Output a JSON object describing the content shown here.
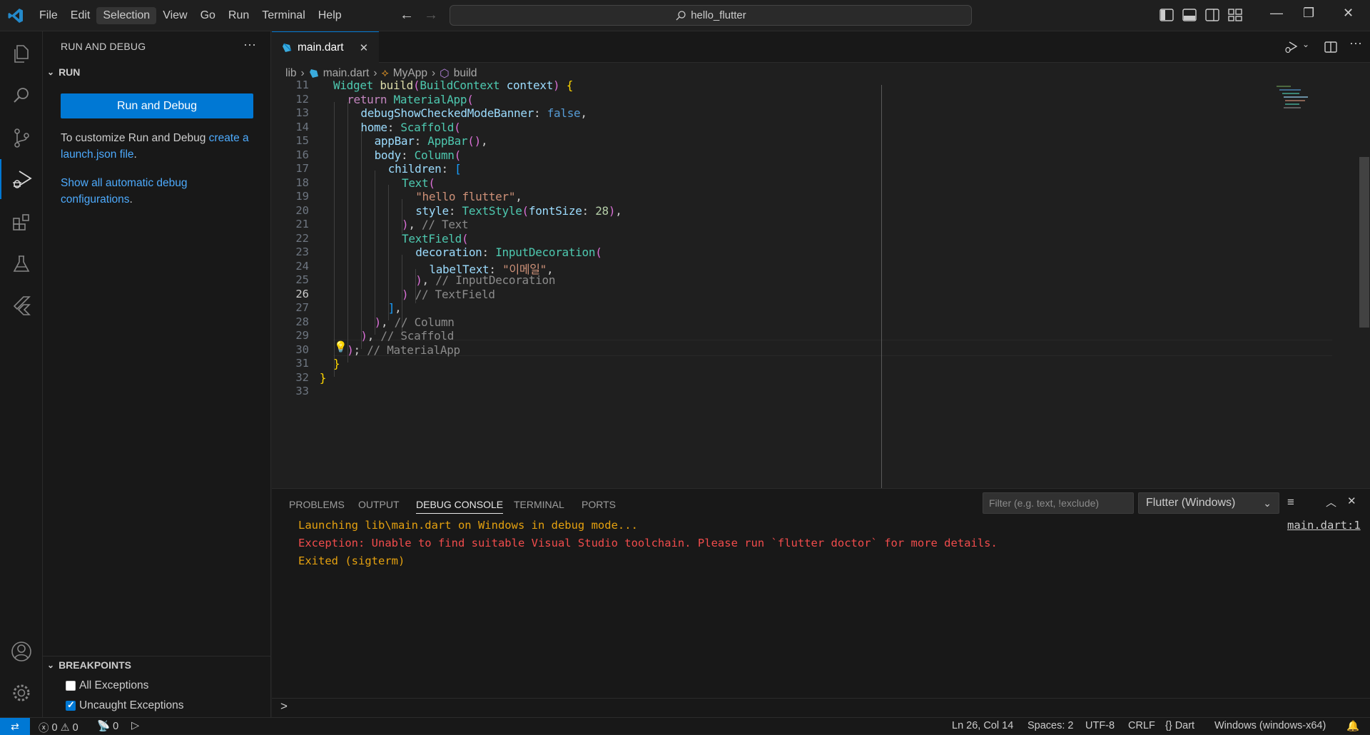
{
  "titlebar": {
    "menu": [
      "File",
      "Edit",
      "Selection",
      "View",
      "Go",
      "Run",
      "Terminal",
      "Help"
    ],
    "active_menu": "Selection",
    "search_text": "hello_flutter"
  },
  "sidebar": {
    "title": "RUN AND DEBUG",
    "run_section": "RUN",
    "run_button": "Run and Debug",
    "customize_text": "To customize Run and Debug ",
    "customize_link": "create a launch.json file",
    "customize_end": ".",
    "show_all_link": "Show all automatic debug configurations",
    "show_all_end": ".",
    "breakpoints_section": "BREAKPOINTS",
    "breakpoints": [
      {
        "label": "All Exceptions",
        "checked": false
      },
      {
        "label": "Uncaught Exceptions",
        "checked": true
      }
    ]
  },
  "editor": {
    "tab": "main.dart",
    "breadcrumb": [
      "lib",
      "main.dart",
      "MyApp",
      "build"
    ],
    "current_line": 26,
    "lines": [
      {
        "n": "11",
        "text": "Widget build(BuildContext context) {"
      },
      {
        "n": "12",
        "text": "return MaterialApp("
      },
      {
        "n": "13",
        "text": "debugShowCheckedModeBanner: false,"
      },
      {
        "n": "14",
        "text": "home: Scaffold("
      },
      {
        "n": "15",
        "text": "appBar: AppBar(),"
      },
      {
        "n": "16",
        "text": "body: Column("
      },
      {
        "n": "17",
        "text": "children: ["
      },
      {
        "n": "18",
        "text": "Text("
      },
      {
        "n": "19",
        "text": "\"hello flutter\","
      },
      {
        "n": "20",
        "text": "style: TextStyle(fontSize: 28),"
      },
      {
        "n": "21",
        "text": "), // Text"
      },
      {
        "n": "22",
        "text": "TextField("
      },
      {
        "n": "23",
        "text": "decoration: InputDecoration("
      },
      {
        "n": "24",
        "text": "labelText: \"이메일\","
      },
      {
        "n": "25",
        "text": "), // InputDecoration"
      },
      {
        "n": "26",
        "text": ") // TextField"
      },
      {
        "n": "27",
        "text": "],"
      },
      {
        "n": "28",
        "text": "), // Column"
      },
      {
        "n": "29",
        "text": "), // Scaffold"
      },
      {
        "n": "30",
        "text": "); // MaterialApp"
      },
      {
        "n": "31",
        "text": "}"
      },
      {
        "n": "32",
        "text": "}"
      },
      {
        "n": "33",
        "text": ""
      }
    ]
  },
  "panel": {
    "tabs": [
      "PROBLEMS",
      "OUTPUT",
      "DEBUG CONSOLE",
      "TERMINAL",
      "PORTS"
    ],
    "active_tab": "DEBUG CONSOLE",
    "filter_placeholder": "Filter (e.g. text, !exclude)",
    "target": "Flutter (Windows)",
    "output": [
      {
        "text": "Launching lib\\main.dart on Windows in debug mode...",
        "color": "#e5a10f"
      },
      {
        "text": "Exception: Unable to find suitable Visual Studio toolchain. Please run `flutter doctor` for more details.",
        "color": "#f14c4c"
      },
      {
        "text": "Exited (sigterm)",
        "color": "#e5a10f"
      }
    ],
    "source_link": "main.dart:1",
    "prompt": ">"
  },
  "statusbar": {
    "errors": "0",
    "warnings": "0",
    "ports": "0",
    "position": "Ln 26, Col 14",
    "spaces": "Spaces: 2",
    "encoding": "UTF-8",
    "eol": "CRLF",
    "language": "Dart",
    "device": "Windows (windows-x64)"
  },
  "colors": {
    "accent": "#0078d4",
    "link": "#4daafc",
    "warning_output": "#e5a10f",
    "error_output": "#f14c4c"
  }
}
